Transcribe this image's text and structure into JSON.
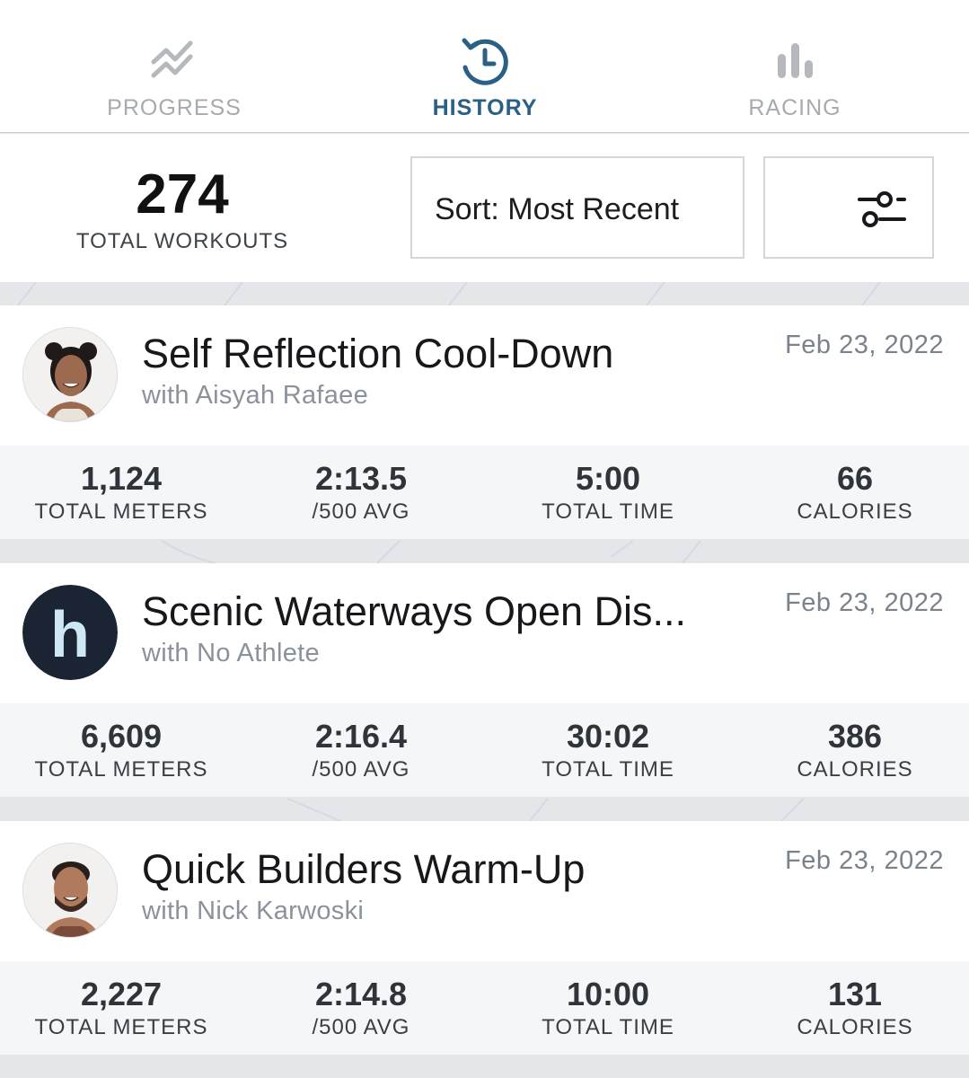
{
  "tabs": [
    {
      "label": "PROGRESS",
      "icon": "trend-lines-icon",
      "active": false
    },
    {
      "label": "HISTORY",
      "icon": "history-clock-icon",
      "active": true
    },
    {
      "label": "RACING",
      "icon": "bar-chart-icon",
      "active": false
    }
  ],
  "summary": {
    "total_workouts": "274",
    "total_label": "TOTAL WORKOUTS",
    "sort_label": "Sort: Most Recent",
    "filter_icon": "filter-sliders-icon"
  },
  "workouts": [
    {
      "title": "Self Reflection Cool-Down",
      "coach": "with Aisyah Rafaee",
      "date": "Feb 23, 2022",
      "avatar": "coach-photo",
      "stats": [
        {
          "value": "1,124",
          "label": "TOTAL METERS"
        },
        {
          "value": "2:13.5",
          "label": "/500 AVG"
        },
        {
          "value": "5:00",
          "label": "TOTAL TIME"
        },
        {
          "value": "66",
          "label": "CALORIES"
        }
      ]
    },
    {
      "title": "Scenic Waterways Open Dis...",
      "coach": "with No Athlete",
      "date": "Feb 23, 2022",
      "avatar": "h",
      "stats": [
        {
          "value": "6,609",
          "label": "TOTAL METERS"
        },
        {
          "value": "2:16.4",
          "label": "/500 AVG"
        },
        {
          "value": "30:02",
          "label": "TOTAL TIME"
        },
        {
          "value": "386",
          "label": "CALORIES"
        }
      ]
    },
    {
      "title": "Quick Builders Warm-Up",
      "coach": "with Nick Karwoski",
      "date": "Feb 23, 2022",
      "avatar": "coach-photo",
      "stats": [
        {
          "value": "2,227",
          "label": "TOTAL METERS"
        },
        {
          "value": "2:14.8",
          "label": "/500 AVG"
        },
        {
          "value": "10:00",
          "label": "TOTAL TIME"
        },
        {
          "value": "131",
          "label": "CALORIES"
        }
      ]
    }
  ],
  "colors": {
    "accent": "#2a5f86",
    "inactive": "#a7abb1",
    "background": "#e4e6ea"
  }
}
